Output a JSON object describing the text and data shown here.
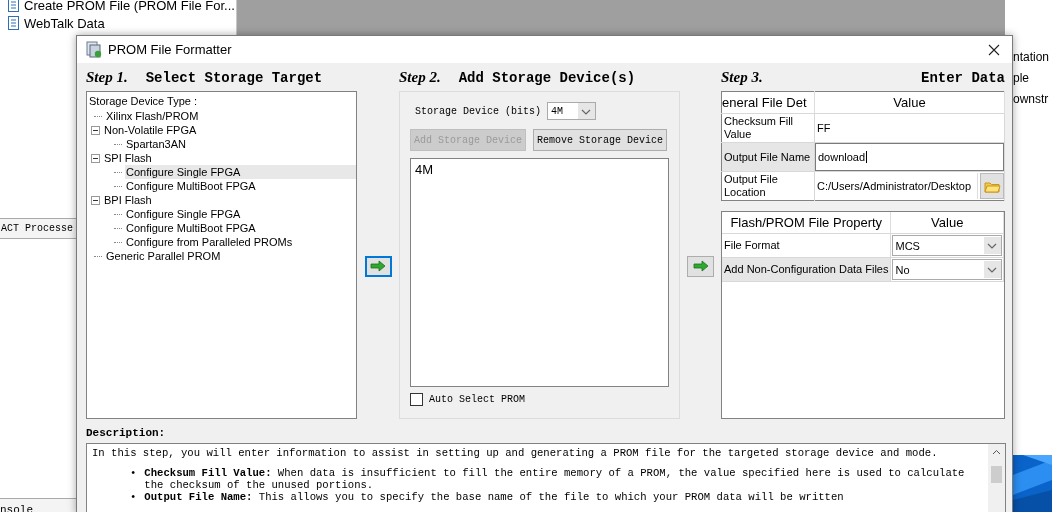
{
  "background_app": {
    "tree_items": [
      {
        "label": "Create PROM File (PROM File For..."
      },
      {
        "label": "WebTalk Data"
      }
    ],
    "panel_tab": "ACT Processe",
    "console_tab": "nsole",
    "right_texts": [
      "ntation",
      "ple",
      "ownstr"
    ]
  },
  "dialog": {
    "title": "PROM File Formatter",
    "step1": {
      "number": "Step 1.",
      "title": "Select Storage Target",
      "tree_caption": "Storage Device Type :",
      "tree": [
        {
          "label": "Xilinx Flash/PROM",
          "selected": false
        },
        {
          "label": "Non-Volatile FPGA",
          "selected": false,
          "expanded": true,
          "children": [
            {
              "label": "Spartan3AN",
              "selected": false
            }
          ]
        },
        {
          "label": "SPI Flash",
          "selected": false,
          "expanded": true,
          "children": [
            {
              "label": "Configure Single FPGA",
              "selected": true
            },
            {
              "label": "Configure MultiBoot FPGA",
              "selected": false
            }
          ]
        },
        {
          "label": "BPI Flash",
          "selected": false,
          "expanded": true,
          "children": [
            {
              "label": "Configure Single FPGA",
              "selected": false
            },
            {
              "label": "Configure MultiBoot FPGA",
              "selected": false
            },
            {
              "label": "Configure from Paralleled PROMs",
              "selected": false
            }
          ]
        },
        {
          "label": "Generic Parallel PROM",
          "selected": false
        }
      ]
    },
    "arrow_buttons": [
      {
        "focused": true
      },
      {
        "focused": false
      }
    ],
    "step2": {
      "number": "Step 2.",
      "title": "Add Storage Device(s)",
      "size_label": "Storage Device (bits)",
      "size_value": "4M",
      "buttons": [
        {
          "label": "Add Storage Device",
          "disabled": true
        },
        {
          "label": "Remove Storage Device",
          "disabled": false
        }
      ],
      "devices": [
        "4M"
      ],
      "auto_select": {
        "label": "Auto Select PROM",
        "checked": false
      }
    },
    "step3": {
      "number": "Step 3.",
      "title": "Enter Data",
      "general_table": {
        "columns": [
          "eneral File Det",
          "Value"
        ],
        "rows": [
          {
            "kind": "text",
            "label": "Checksum Fill Value",
            "value": "FF",
            "selected": false
          },
          {
            "kind": "input",
            "label": "Output File Name",
            "value": "download",
            "selected": true
          },
          {
            "kind": "browse",
            "label": "Output File Location",
            "value": "C:/Users/Administrator/Desktop",
            "selected": false
          }
        ]
      },
      "property_table": {
        "columns": [
          "Flash/PROM File Property",
          "Value"
        ],
        "rows": [
          {
            "label": "File Format",
            "value": "MCS",
            "selected": false
          },
          {
            "label": "Add Non-Configuration Data Files",
            "value": "No",
            "selected": true
          }
        ]
      }
    },
    "description": {
      "label": "Description:",
      "intro": "In this step, you will enter information to assist in setting up and generating a PROM file for the targeted storage device and mode.",
      "bullets": [
        {
          "marker": "•",
          "text": "**Checksum Fill Value:** When data is insufficient to fill the entire memory of a PROM, the value specified here is used to calculate the checksum of the unused portions."
        },
        {
          "marker": "•",
          "text": "**Output File Name:** This allows you to specify the base name of the file to which your PROM data will be written"
        }
      ]
    }
  }
}
